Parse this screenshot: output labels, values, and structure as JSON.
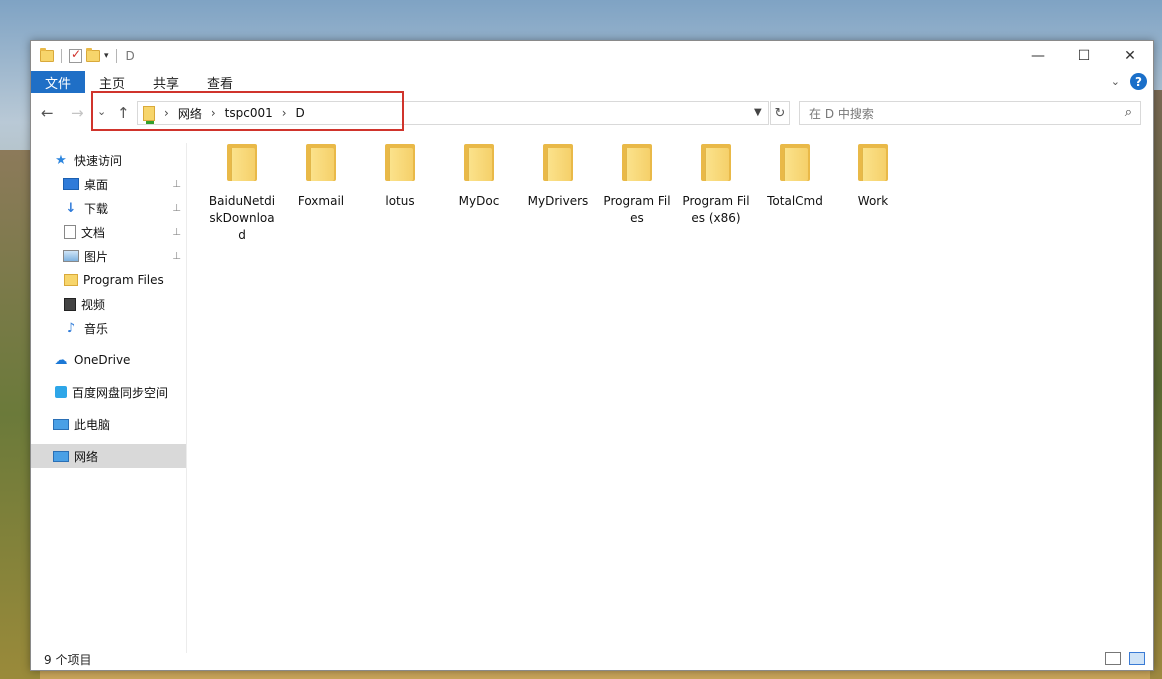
{
  "window": {
    "title": "D",
    "controls": {
      "minimize": "—",
      "maximize": "☐",
      "close": "✕"
    }
  },
  "ribbon": {
    "file_tab": "文件",
    "tabs": [
      "主页",
      "共享",
      "查看"
    ],
    "help": "?"
  },
  "nav": {
    "back": "←",
    "forward": "→",
    "recent": "⌄",
    "up": "↑",
    "breadcrumbs": [
      "网络",
      "tspc001",
      "D"
    ],
    "separator": "›",
    "refresh": "↻",
    "search_placeholder": "在 D 中搜索"
  },
  "sidebar": {
    "items": [
      {
        "label": "快速访问",
        "icon": "quick-access-star-icon",
        "glyph": "★"
      },
      {
        "label": "桌面",
        "icon": "desktop-icon",
        "pinned": true
      },
      {
        "label": "下载",
        "icon": "download-arrow-icon",
        "glyph": "↓",
        "pinned": true
      },
      {
        "label": "文档",
        "icon": "document-icon",
        "pinned": true
      },
      {
        "label": "图片",
        "icon": "pictures-icon",
        "pinned": true
      },
      {
        "label": "Program Files",
        "icon": "folder-icon"
      },
      {
        "label": "视频",
        "icon": "video-icon"
      },
      {
        "label": "音乐",
        "icon": "music-note-icon",
        "glyph": "♪"
      },
      {
        "label": "OneDrive",
        "icon": "onedrive-cloud-icon",
        "glyph": "☁"
      },
      {
        "label": "百度网盘同步空间",
        "icon": "baidu-netdisk-icon"
      },
      {
        "label": "此电脑",
        "icon": "this-pc-icon"
      },
      {
        "label": "网络",
        "icon": "network-icon",
        "selected": true
      }
    ],
    "pin_glyph": "📌"
  },
  "files": [
    {
      "name": "BaiduNetdiskDownload"
    },
    {
      "name": "Foxmail"
    },
    {
      "name": "lotus"
    },
    {
      "name": "MyDoc"
    },
    {
      "name": "MyDrivers"
    },
    {
      "name": "Program Files"
    },
    {
      "name": "Program Files (x86)"
    },
    {
      "name": "TotalCmd"
    },
    {
      "name": "Work"
    }
  ],
  "status": {
    "item_count": "9 个项目"
  }
}
